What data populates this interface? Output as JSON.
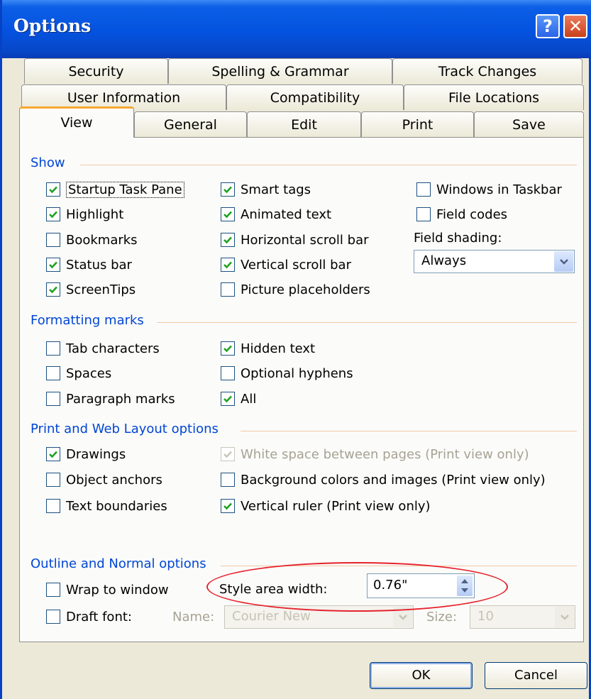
{
  "window": {
    "title": "Options"
  },
  "title_buttons": {
    "help": "?",
    "close": "✕"
  },
  "tabs": {
    "row1": [
      "Security",
      "Spelling & Grammar",
      "Track Changes"
    ],
    "row2": [
      "User Information",
      "Compatibility",
      "File Locations"
    ],
    "row3": [
      "View",
      "General",
      "Edit",
      "Print",
      "Save"
    ],
    "active": "View"
  },
  "show": {
    "heading": "Show",
    "col1": [
      {
        "label": "Startup Task Pane",
        "checked": true
      },
      {
        "label": "Highlight",
        "checked": true
      },
      {
        "label": "Bookmarks",
        "checked": false
      },
      {
        "label": "Status bar",
        "checked": true
      },
      {
        "label": "ScreenTips",
        "checked": true
      }
    ],
    "col2": [
      {
        "label": "Smart tags",
        "checked": true
      },
      {
        "label": "Animated text",
        "checked": true
      },
      {
        "label": "Horizontal scroll bar",
        "checked": true
      },
      {
        "label": "Vertical scroll bar",
        "checked": true
      },
      {
        "label": "Picture placeholders",
        "checked": false
      }
    ],
    "col3": [
      {
        "label": "Windows in Taskbar",
        "checked": false
      },
      {
        "label": "Field codes",
        "checked": false
      }
    ],
    "field_shading_label": "Field shading:",
    "field_shading_value": "Always"
  },
  "formatting": {
    "heading": "Formatting marks",
    "col1": [
      {
        "label": "Tab characters",
        "checked": false
      },
      {
        "label": "Spaces",
        "checked": false
      },
      {
        "label": "Paragraph marks",
        "checked": false
      }
    ],
    "col2": [
      {
        "label": "Hidden text",
        "checked": true
      },
      {
        "label": "Optional hyphens",
        "checked": false
      },
      {
        "label": "All",
        "checked": true
      }
    ]
  },
  "print_web": {
    "heading": "Print and Web Layout options",
    "col1": [
      {
        "label": "Drawings",
        "checked": true
      },
      {
        "label": "Object anchors",
        "checked": false
      },
      {
        "label": "Text boundaries",
        "checked": false
      }
    ],
    "col2": [
      {
        "label": "White space between pages (Print view only)",
        "checked": true,
        "disabled": true
      },
      {
        "label": "Background colors and images (Print view only)",
        "checked": false
      },
      {
        "label": "Vertical ruler (Print view only)",
        "checked": true
      }
    ]
  },
  "outline": {
    "heading": "Outline and Normal options",
    "wrap": {
      "label": "Wrap to window",
      "checked": false
    },
    "draft": {
      "label": "Draft font:",
      "checked": false
    },
    "style_area_label": "Style area width:",
    "style_area_value": "0.76\"",
    "name_label": "Name:",
    "name_value": "Courier New",
    "size_label": "Size:",
    "size_value": "10"
  },
  "buttons": {
    "ok": "OK",
    "cancel": "Cancel"
  },
  "colors": {
    "title_blue": "#0452df",
    "group_heading": "#0046d5",
    "annotation_ellipse": "#e6222c"
  }
}
